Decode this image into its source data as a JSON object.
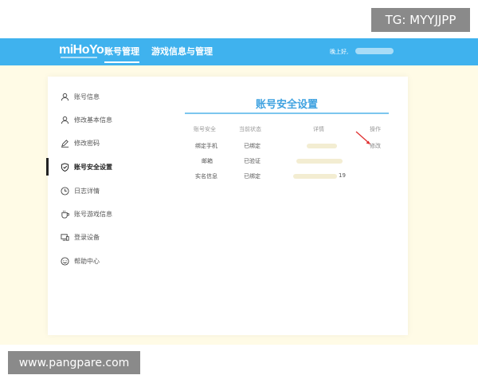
{
  "watermark_top": "TG: MYYJJPP",
  "header": {
    "logo": "miHoYo",
    "nav": [
      "账号管理",
      "游戏信息与管理"
    ],
    "greeting": "晚上好,"
  },
  "sidebar": {
    "items": [
      {
        "label": "账号信息",
        "icon": "user-icon"
      },
      {
        "label": "修改基本信息",
        "icon": "user-edit-icon"
      },
      {
        "label": "修改密码",
        "icon": "pencil-icon"
      },
      {
        "label": "账号安全设置",
        "icon": "shield-icon"
      },
      {
        "label": "日志详情",
        "icon": "clock-icon"
      },
      {
        "label": "账号游戏信息",
        "icon": "cup-icon"
      },
      {
        "label": "登录设备",
        "icon": "device-icon"
      },
      {
        "label": "帮助中心",
        "icon": "help-icon"
      }
    ]
  },
  "main": {
    "title": "账号安全设置",
    "columns": [
      "账号安全",
      "当前状态",
      "详情",
      "操作"
    ],
    "rows": [
      {
        "item": "绑定手机",
        "status": "已绑定",
        "detail": "",
        "action": "修改"
      },
      {
        "item": "邮箱",
        "status": "已验证",
        "detail": "",
        "action": ""
      },
      {
        "item": "实名信息",
        "status": "已绑定",
        "detail": "19",
        "action": ""
      }
    ]
  },
  "watermark_bottom": "www.pangpare.com",
  "colors": {
    "header": "#3fb2ee",
    "accent": "#3fa2e0",
    "arrow": "#e03030"
  }
}
